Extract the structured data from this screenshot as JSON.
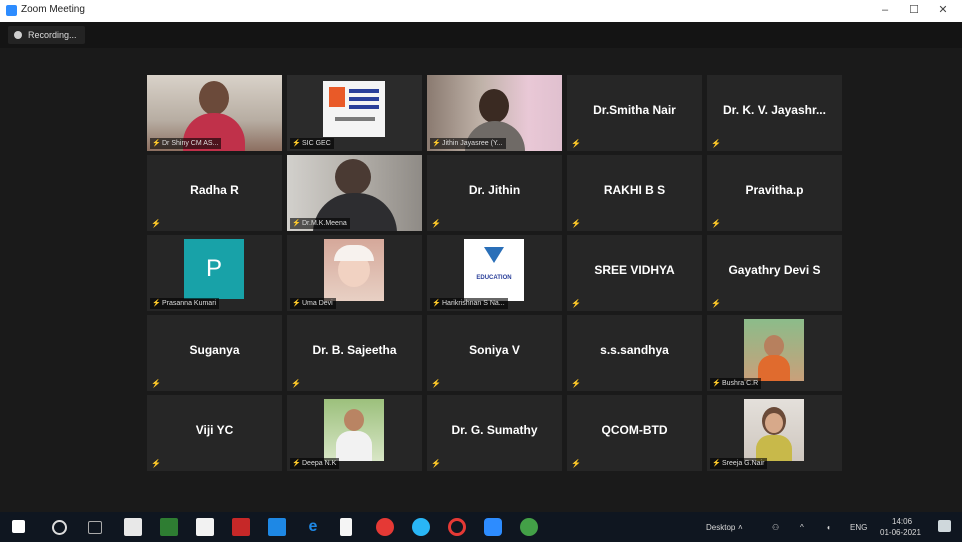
{
  "window": {
    "title": "Zoom Meeting",
    "minimize": "–",
    "maximize": "☐",
    "close": "✕"
  },
  "recording": {
    "label": "Recording..."
  },
  "tiles": [
    {
      "name": "",
      "label": "Dr Shiny CM AS...",
      "kind": "video"
    },
    {
      "name": "",
      "label": "SIC GEC",
      "kind": "logo"
    },
    {
      "name": "",
      "label": "Jithin Jayasree (Y...",
      "kind": "video"
    },
    {
      "name": "Dr.Smitha Nair",
      "kind": "name"
    },
    {
      "name": "Dr. K. V. Jayashr...",
      "kind": "name"
    },
    {
      "name": "Radha R",
      "kind": "name"
    },
    {
      "name": "",
      "label": "Dr.M.K.Meena",
      "kind": "video",
      "active": true
    },
    {
      "name": "Dr. Jithin",
      "kind": "name"
    },
    {
      "name": "RAKHI B S",
      "kind": "name"
    },
    {
      "name": "Pravitha.p",
      "kind": "name"
    },
    {
      "name": "",
      "label": "Prasanna Kumari",
      "kind": "initial",
      "initial": "P"
    },
    {
      "name": "",
      "label": "Uma Devi",
      "kind": "photo"
    },
    {
      "name": "",
      "label": "Harikrishnan S Na...",
      "kind": "edu"
    },
    {
      "name": "SREE VIDHYA",
      "kind": "name"
    },
    {
      "name": "Gayathry Devi S",
      "kind": "name"
    },
    {
      "name": "Suganya",
      "kind": "name"
    },
    {
      "name": "Dr. B. Sajeetha",
      "kind": "name"
    },
    {
      "name": "Soniya V",
      "kind": "name"
    },
    {
      "name": "s.s.sandhya",
      "kind": "name"
    },
    {
      "name": "",
      "label": "Bushra C.R",
      "kind": "photo"
    },
    {
      "name": "Viji YC",
      "kind": "name"
    },
    {
      "name": "",
      "label": "Deepa N.K",
      "kind": "photo"
    },
    {
      "name": "Dr. G. Sumathy",
      "kind": "name"
    },
    {
      "name": "QCOM-BTD",
      "kind": "name"
    },
    {
      "name": "",
      "label": "Sreeja G.Nair",
      "kind": "photo"
    }
  ],
  "edu_logo_text": "EDUCATION",
  "taskbar": {
    "desktop": "Desktop",
    "lang": "ENG",
    "time": "14:06",
    "date": "01-06-2021"
  },
  "colors": {
    "accent": "#2d8cff",
    "active_border": "#9ccc3d",
    "mic_muted": "#e0403a"
  }
}
